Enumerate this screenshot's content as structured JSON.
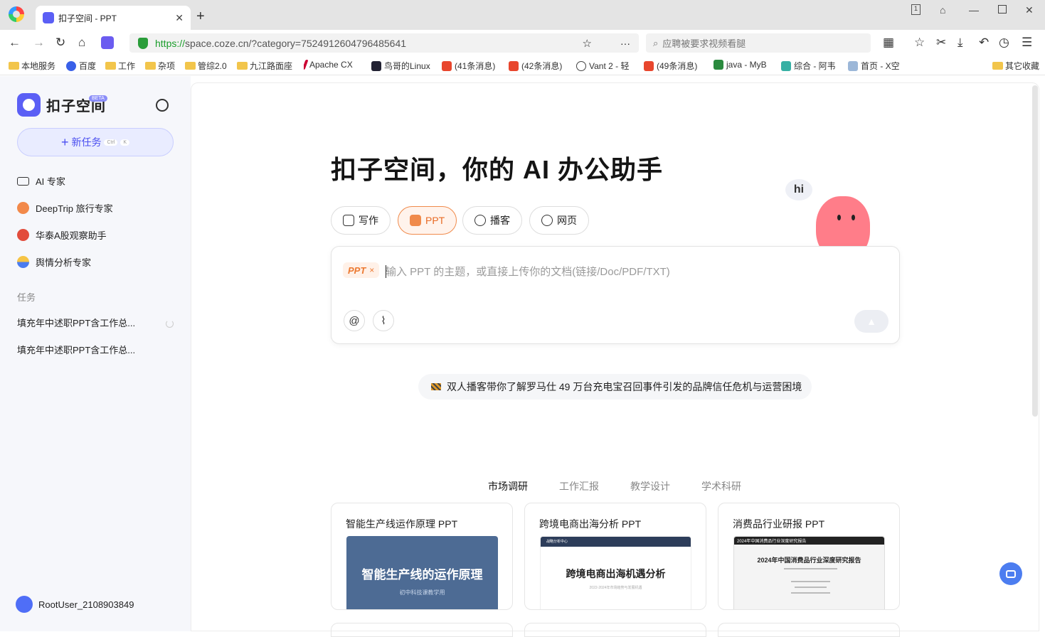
{
  "browser": {
    "tab_title": "扣子空间 - PPT",
    "url_scheme": "https://",
    "url_rest": "space.coze.cn/?category=7524912604796485641",
    "search_placeholder": "应聘被要求视频看腿",
    "bookmarks": [
      "本地服务",
      "百度",
      "工作",
      "杂项",
      "管综2.0",
      "九江路面座",
      "Apache CX",
      "鸟哥的Linux",
      "(41条消息)",
      "(42条消息)",
      "Vant 2 - 轻",
      "(49条消息)",
      "java - MyB",
      "综合 - 阿韦",
      "首页 - X空",
      "其它收藏"
    ]
  },
  "sidebar": {
    "brand": "扣子空间",
    "beta": "BETA",
    "new_task": "新任务",
    "kbd_ctrl": "Ctrl",
    "kbd_k": "K",
    "experts": [
      "AI 专家",
      "DeepTrip 旅行专家",
      "华泰A股观察助手",
      "舆情分析专家"
    ],
    "section_tasks": "任务",
    "tasks": [
      "填充年中述职PPT含工作总...",
      "填充年中述职PPT含工作总..."
    ],
    "user": "RootUser_2108903849"
  },
  "main": {
    "headline": "扣子空间，你的 AI 办公助手",
    "modes": [
      "写作",
      "PPT",
      "播客",
      "网页"
    ],
    "active_mode": "PPT",
    "mascot_text": "hi",
    "input": {
      "tag": "PPT",
      "tag_remove": "×",
      "placeholder": "输入 PPT 的主题，或直接上传你的文档(链接/Doc/PDF/TXT)"
    },
    "news": "双人播客带你了解罗马仕 49 万台充电宝召回事件引发的品牌信任危机与运营困境",
    "categories": [
      "市场调研",
      "工作汇报",
      "教学设计",
      "学术科研"
    ],
    "cards": [
      {
        "title": "智能生产线运作原理 PPT",
        "thumb_title": "智能生产线的运作原理",
        "thumb_sub": "初中科技课教学用"
      },
      {
        "title": "跨境电商出海分析 PPT",
        "thumb_title": "跨境电商出海机遇分析",
        "thumb_bar": "战略分析中心",
        "thumb_sub": "2022-2024年市场趋势与发展机遇"
      },
      {
        "title": "消费品行业研报 PPT",
        "thumb_title": "2024年中国消费品行业深度研究报告",
        "thumb_bar": "2024年中国消费品行业深度研究报告"
      }
    ]
  }
}
